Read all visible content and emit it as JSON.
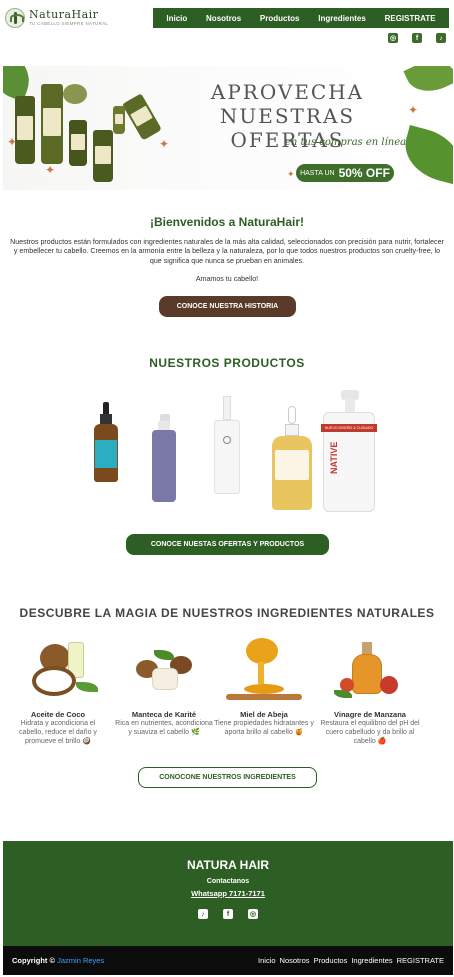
{
  "header": {
    "logo_name": "NaturaHair",
    "logo_tagline": "TU CABELLO SIEMPRE NATURAL",
    "nav": [
      "Inicio",
      "Nosotros",
      "Productos",
      "Ingredientes",
      "REGISTRATE"
    ],
    "social": [
      "instagram-icon",
      "facebook-icon",
      "tiktok-icon"
    ]
  },
  "banner": {
    "line1": "APROVECHA",
    "line2": "NUESTRAS OFERTAS",
    "sub": "en tus compras en línea",
    "pill_small": "HASTA UN",
    "pill_big": "50% OFF"
  },
  "welcome": {
    "title": "¡Bienvenidos a NaturaHair!",
    "text": "Nuestros productos están formulados con ingredientes naturales de la más alta calidad, seleccionados con precisión para nutrir, fortalecer y embellecer tu cabello. Creemos en la armonía entre la belleza y la naturaleza, por lo que todos nuestros productos son cruelty-free, lo que significa que nunca se prueban en animales.",
    "love": "Amamos tu cabello!",
    "button": "CONOCE NUESTRA HISTORIA"
  },
  "products": {
    "title": "NUESTROS PRODUCTOS",
    "button": "CONOCE NUESTAS OFERTAS Y PRODUCTOS",
    "native_label": "NATIVE",
    "native_banner": "NUEVO DISEÑO & CUIDADO"
  },
  "ingredients": {
    "title": "DESCUBRE LA MAGIA DE NUESTROS INGREDIENTES NATURALES",
    "items": [
      {
        "name": "Aceite de Coco",
        "desc": "Hidrata y acondiciona el cabello, reduce el daño y promueve el brillo 🥥"
      },
      {
        "name": "Manteca de Karité",
        "desc": "Rica en nutrientes, acondiciona y suaviza el cabello 🌿"
      },
      {
        "name": "Miel de Abeja",
        "desc": "Tiene propiedades hidratantes y aporta brillo al cabello 🍯"
      },
      {
        "name": "Vinagre de Manzana",
        "desc": "Restaura el equilibrio del pH del cuero cabelludo y da brillo al cabello 🍎"
      }
    ],
    "button": "CONOCONE NUESTROS INGREDIENTES"
  },
  "footer": {
    "title": "NATURA HAIR",
    "contact": "Contactanos",
    "whatsapp": "Whatsapp 7171-7171",
    "social": [
      "tiktok-icon",
      "facebook-icon",
      "instagram-icon"
    ]
  },
  "bottom": {
    "copyright": "Copyright ©",
    "author": "Jazmin Reyes",
    "nav": [
      "Inicio",
      "Nosotros",
      "Productos",
      "Ingredientes",
      "REGISTRATE"
    ]
  },
  "colors": {
    "primary_green": "#2d5e24",
    "brown": "#5a3b2a",
    "author_blue": "#3ea0ff"
  }
}
